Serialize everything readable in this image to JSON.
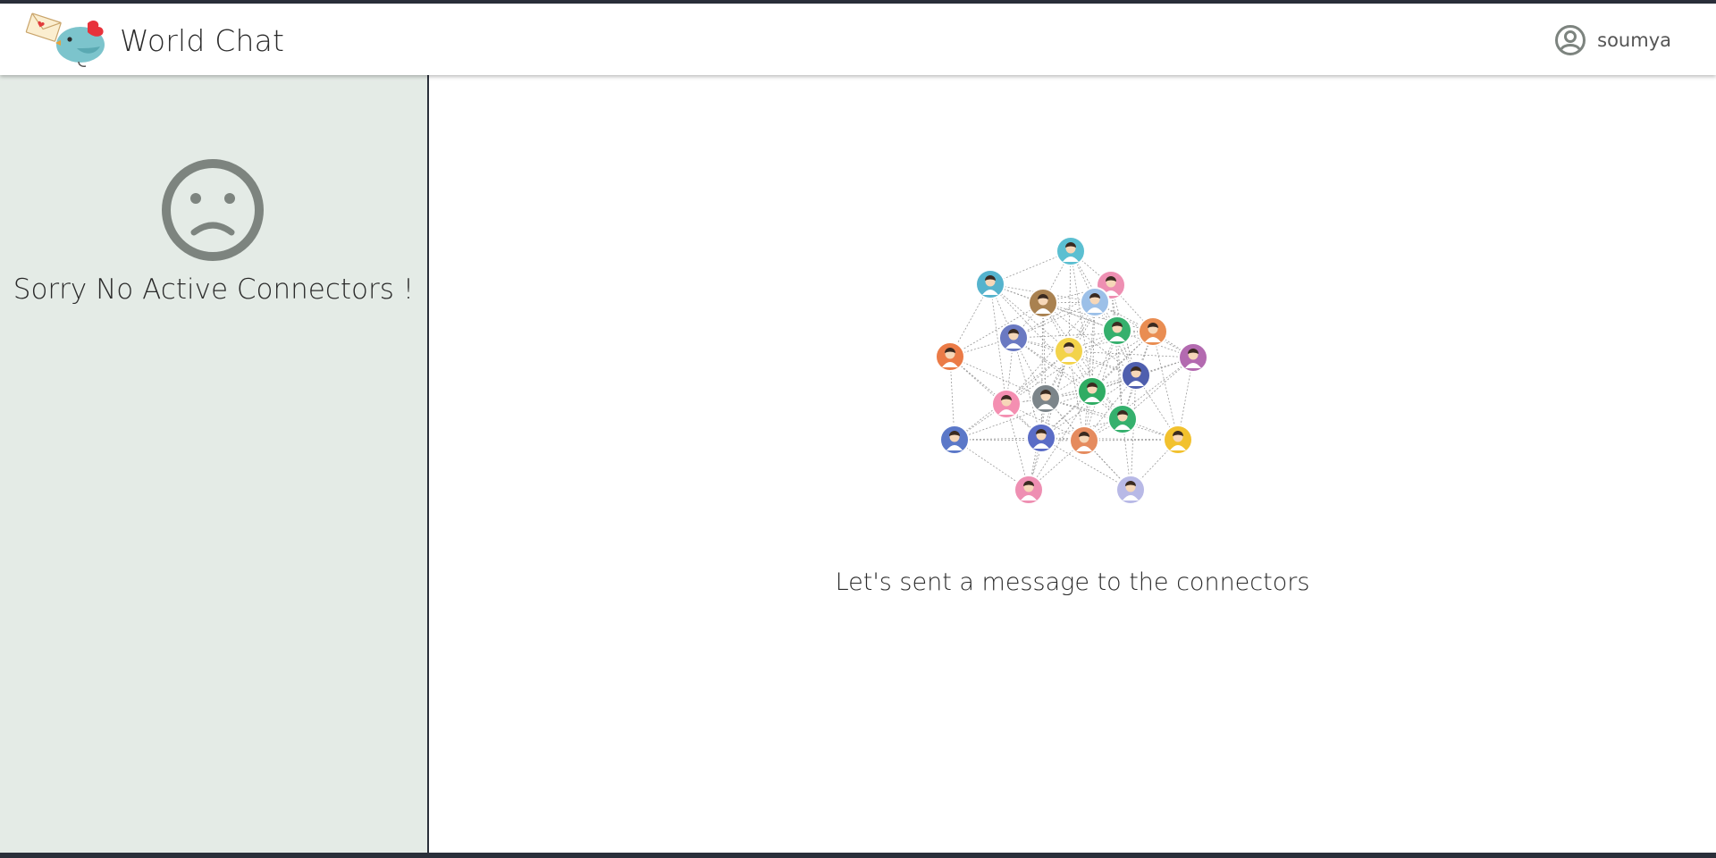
{
  "header": {
    "app_title": "World Chat",
    "logo_icon": "bird-mail-logo-icon",
    "user": {
      "icon": "user-circle-icon",
      "name": "soumya"
    }
  },
  "sidebar": {
    "empty_icon": "sad-face-icon",
    "empty_message": "Sorry No Active Connectors !"
  },
  "main": {
    "illustration_icon": "connected-people-network-icon",
    "message": "Let's sent a message to the connectors"
  },
  "colors": {
    "sidebar_bg": "#e4ebe6",
    "icon_gray": "#7d847f",
    "text_dark": "#2b2b2b",
    "border_dark": "#2a2f3a"
  }
}
